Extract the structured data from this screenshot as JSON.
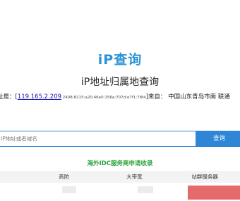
{
  "logo": "iP查询",
  "title": "iP地址归属地查询",
  "info": {
    "prefix": "址是：[",
    "ipv4": "119.165.2.209",
    "ipv6": " 2408:8215:a20:46e0:156a:707d:e7f1:78f4",
    "suffix": "]来自： 中国山东青岛市南 联通"
  },
  "search": {
    "placeholder": "IP地址或者域名",
    "button": "查询"
  },
  "section_title": "海外IDC服务商申请收录",
  "table": {
    "headers": [
      "",
      "高防",
      "大带宽",
      "站群服务器"
    ]
  },
  "colors": {
    "brand": "#2a93d5",
    "button": "#2f86d6",
    "section": "#2aa43b",
    "highlight": "#e56a6a"
  }
}
